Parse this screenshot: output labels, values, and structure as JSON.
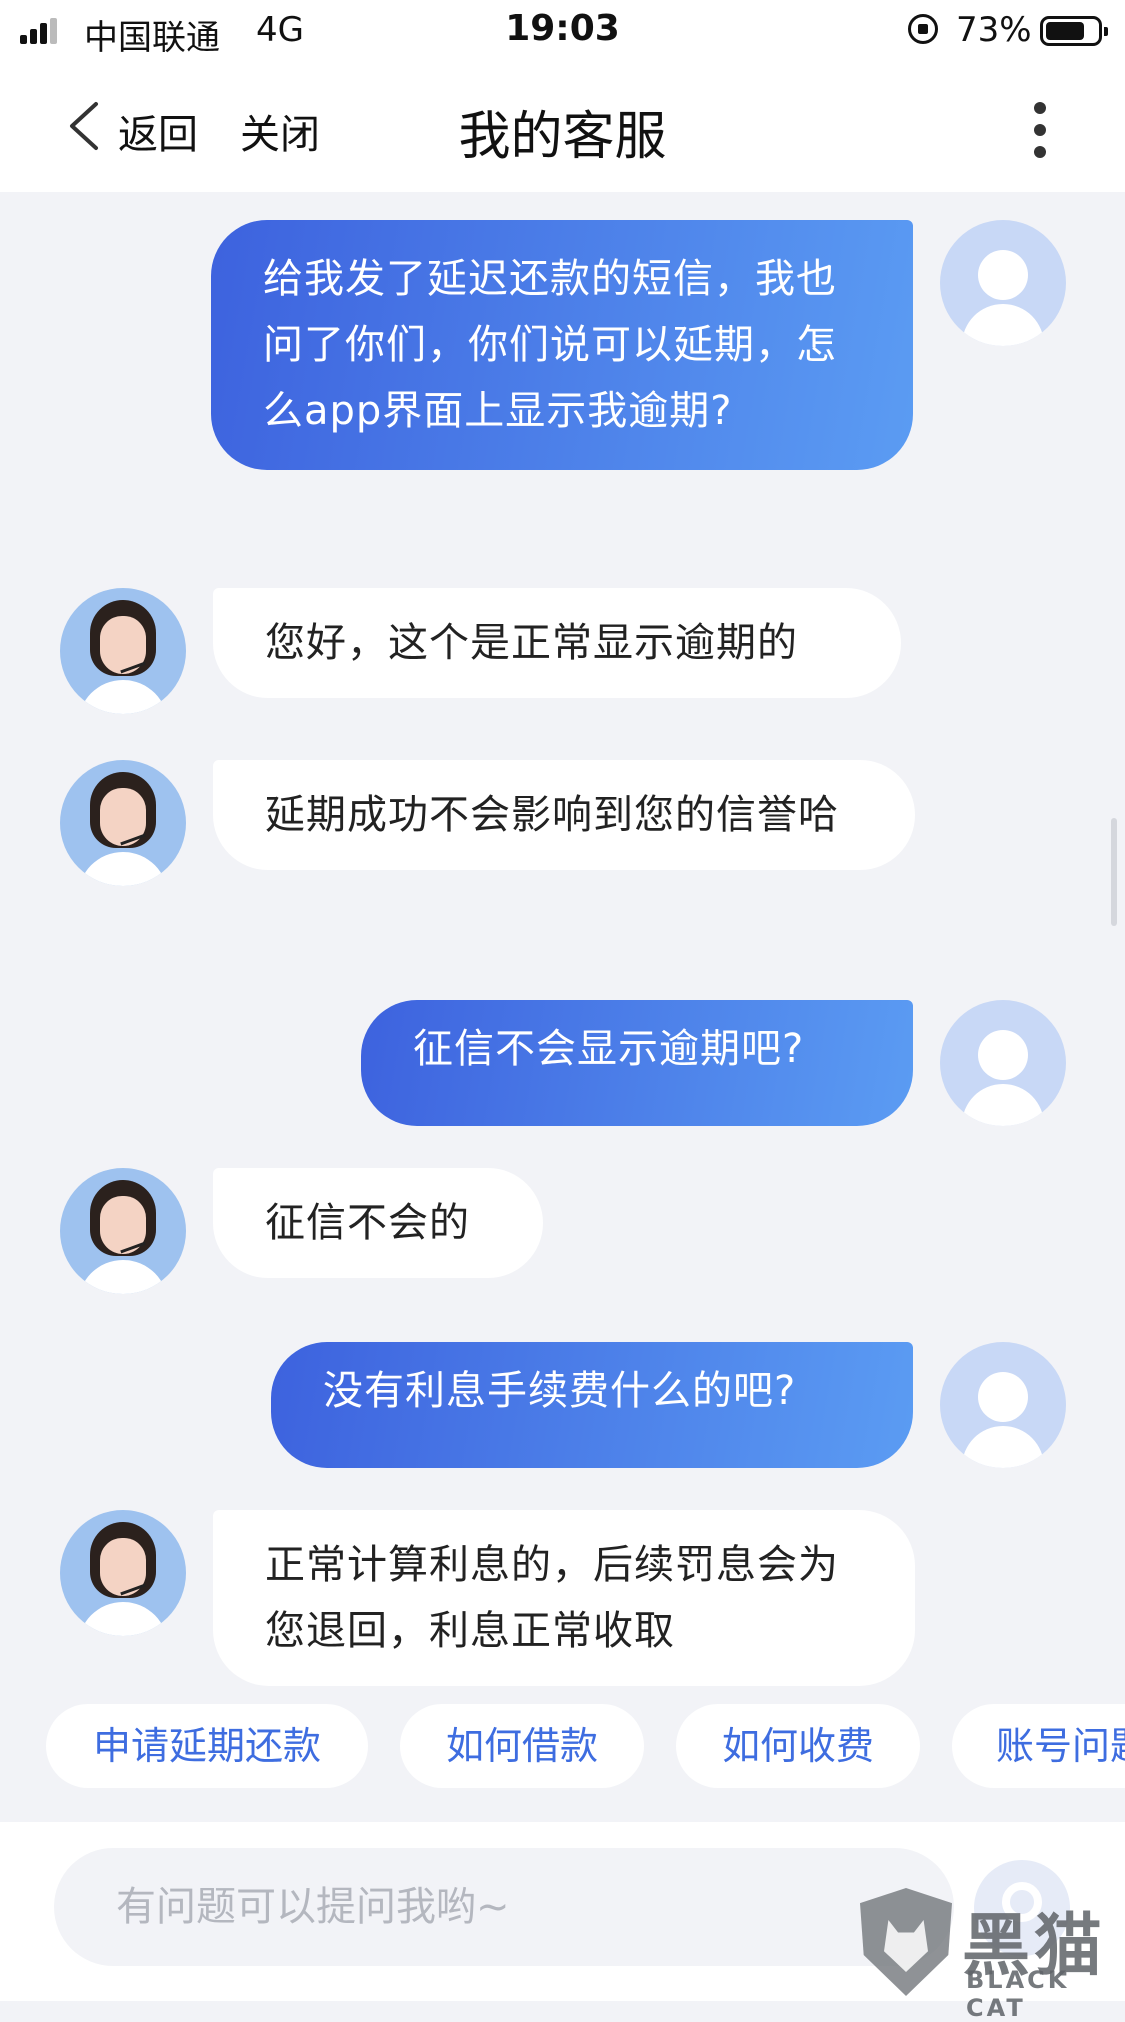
{
  "status_bar": {
    "carrier": "中国联通",
    "network": "4G",
    "time": "19:03",
    "battery": "73%"
  },
  "nav": {
    "back_label": "返回",
    "close_label": "关闭",
    "title": "我的客服"
  },
  "messages": [
    {
      "from": "user",
      "text": "给我发了延迟还款的短信，我也问了你们，你们说可以延期，怎么app界面上显示我逾期?"
    },
    {
      "from": "agent",
      "text": "您好，这个是正常显示逾期的"
    },
    {
      "from": "agent",
      "text": "延期成功不会影响到您的信誉哈"
    },
    {
      "from": "user",
      "text": "征信不会显示逾期吧?"
    },
    {
      "from": "agent",
      "text": "征信不会的"
    },
    {
      "from": "user",
      "text": "没有利息手续费什么的吧?"
    },
    {
      "from": "agent",
      "text": "正常计算利息的，后续罚息会为您退回，利息正常收取"
    }
  ],
  "quick_replies": [
    "申请延期还款",
    "如何借款",
    "如何收费",
    "账号问题"
  ],
  "input": {
    "placeholder": "有问题可以提问我哟~"
  },
  "watermark": {
    "title": "黑猫",
    "subtitle": "BLACK CAT"
  }
}
